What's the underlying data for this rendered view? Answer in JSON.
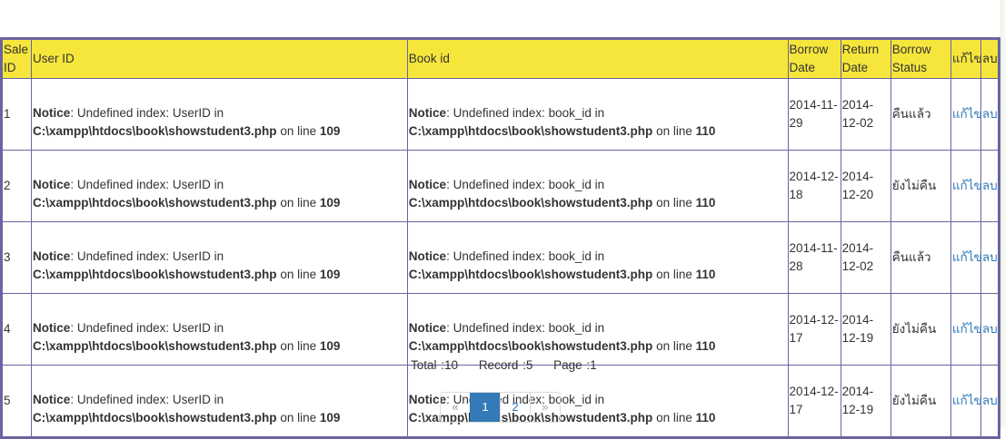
{
  "headers": [
    "Sale ID",
    "User ID",
    "Book id",
    "Borrow Date",
    "Return Date",
    "Borrow Status",
    "แก้ไข",
    "ลบ"
  ],
  "rows": [
    {
      "id": "1",
      "borrow": "2014-11-29",
      "return": "2014-12-02",
      "status": "คืนแล้ว"
    },
    {
      "id": "2",
      "borrow": "2014-12-18",
      "return": "2014-12-20",
      "status": "ยังไม่คืน"
    },
    {
      "id": "3",
      "borrow": "2014-11-28",
      "return": "2014-12-02",
      "status": "คืนแล้ว"
    },
    {
      "id": "4",
      "borrow": "2014-12-17",
      "return": "2014-12-19",
      "status": "ยังไม่คืน"
    },
    {
      "id": "5",
      "borrow": "2014-12-17",
      "return": "2014-12-19",
      "status": "ยังไม่คืน"
    }
  ],
  "notice": {
    "label": "Notice",
    "user_msg": ": Undefined index: UserID in",
    "book_msg": ": Undefined index: book_id in",
    "path": "C:\\xampp\\htdocs\\book\\showstudent3.php",
    "on_line": " on line ",
    "user_line": "109",
    "book_line": "110"
  },
  "edit_label": "แก้ไข",
  "delete_label": "ลบ",
  "summary": {
    "total": "Total :10",
    "record": "Record :5",
    "page": "Page :1"
  },
  "pager": {
    "prev": "«",
    "pages": [
      "1",
      "2"
    ],
    "next": "»",
    "active": "1"
  }
}
